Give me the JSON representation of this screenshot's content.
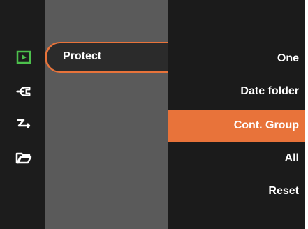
{
  "sidebar": {
    "items": [
      {
        "icon": "play-icon"
      },
      {
        "icon": "wrench-icon"
      },
      {
        "icon": "transfer-icon"
      },
      {
        "icon": "folder-icon"
      }
    ]
  },
  "menu": {
    "protect_label": "Protect",
    "options": [
      {
        "label": "One"
      },
      {
        "label": "Date folder"
      },
      {
        "label": "Cont. Group",
        "selected": true
      },
      {
        "label": "All"
      },
      {
        "label": "Reset"
      }
    ]
  },
  "colors": {
    "accent": "#e8733a",
    "play_icon": "#4cc04c"
  }
}
